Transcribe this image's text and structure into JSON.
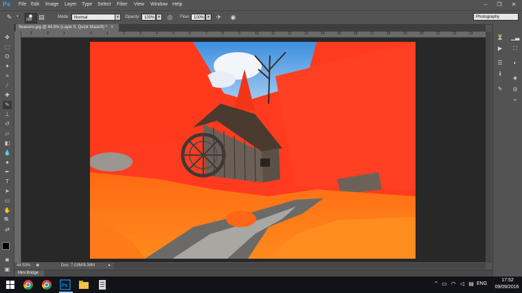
{
  "app": {
    "logo": "Ps"
  },
  "menu": [
    "File",
    "Edit",
    "Image",
    "Layer",
    "Type",
    "Select",
    "Filter",
    "View",
    "Window",
    "Help"
  ],
  "window_controls": {
    "minimize": "–",
    "restore": "❐",
    "close": "✕"
  },
  "options": {
    "brush_size": "200",
    "mode_label": "Mode:",
    "mode_value": "Normal",
    "opacity_label": "Opacity:",
    "opacity_value": "100%",
    "flow_label": "Flow:",
    "flow_value": "100%"
  },
  "workspace": "Photography",
  "document_tab": {
    "title": "Seasons.jpg @ 44.5% (Layer 0, Quick Mask/8) *",
    "close": "×"
  },
  "ruler": {
    "top_ticks": [
      "3",
      "2",
      "1",
      "0",
      "1",
      "2",
      "3",
      "4",
      "5",
      "6",
      "7",
      "8",
      "9",
      "10",
      "11",
      "12",
      "13",
      "14",
      "15",
      "16",
      "17",
      "18",
      "19",
      "20",
      "21",
      "22",
      "23"
    ]
  },
  "status": {
    "zoom": "44.53%",
    "doc": "Doc: 7.03M/9.38M"
  },
  "minibridge": {
    "label": "Mini Bridge"
  },
  "taskbar": {
    "lang": "ENG",
    "time": "17:52",
    "date": "09/09/2016"
  },
  "colors": {
    "accent": "#31a8ff",
    "quickmask": "#ff3b1f",
    "panel": "#535353"
  }
}
